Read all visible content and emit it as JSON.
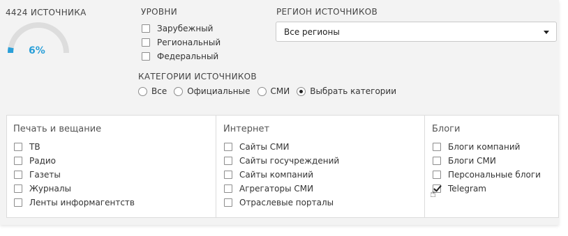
{
  "sources": {
    "count_label": "4424 ИСТОЧНИКА",
    "percent": "6%",
    "fraction": 0.06
  },
  "levels": {
    "title": "УРОВНИ",
    "items": [
      {
        "label": "Зарубежный",
        "checked": false
      },
      {
        "label": "Региональный",
        "checked": false
      },
      {
        "label": "Федеральный",
        "checked": false
      }
    ]
  },
  "region": {
    "title": "РЕГИОН ИСТОЧНИКОВ",
    "selected": "Все регионы"
  },
  "categories": {
    "title": "КАТЕГОРИИ ИСТОЧНИКОВ",
    "options": [
      {
        "label": "Все",
        "selected": false
      },
      {
        "label": "Официальные",
        "selected": false
      },
      {
        "label": "СМИ",
        "selected": false
      },
      {
        "label": "Выбрать категории",
        "selected": true
      }
    ]
  },
  "groups": [
    {
      "title": "Печать и вещание",
      "items": [
        {
          "label": "ТВ",
          "checked": false
        },
        {
          "label": "Радио",
          "checked": false
        },
        {
          "label": "Газеты",
          "checked": false
        },
        {
          "label": "Журналы",
          "checked": false
        },
        {
          "label": "Ленты информагентств",
          "checked": false
        }
      ]
    },
    {
      "title": "Интернет",
      "items": [
        {
          "label": "Сайты СМИ",
          "checked": false
        },
        {
          "label": "Сайты госучреждений",
          "checked": false
        },
        {
          "label": "Сайты компаний",
          "checked": false
        },
        {
          "label": "Агрегаторы СМИ",
          "checked": false
        },
        {
          "label": "Отраслевые порталы",
          "checked": false
        }
      ]
    },
    {
      "title": "Блоги",
      "items": [
        {
          "label": "Блоги компаний",
          "checked": false
        },
        {
          "label": "Блоги СМИ",
          "checked": false
        },
        {
          "label": "Персональные блоги",
          "checked": false
        },
        {
          "label": "Telegram",
          "checked": true
        }
      ]
    }
  ],
  "colors": {
    "gauge_fill": "#2a9fd8",
    "gauge_track": "#dddddd"
  },
  "cursor_icon": "hand-pointer-icon"
}
